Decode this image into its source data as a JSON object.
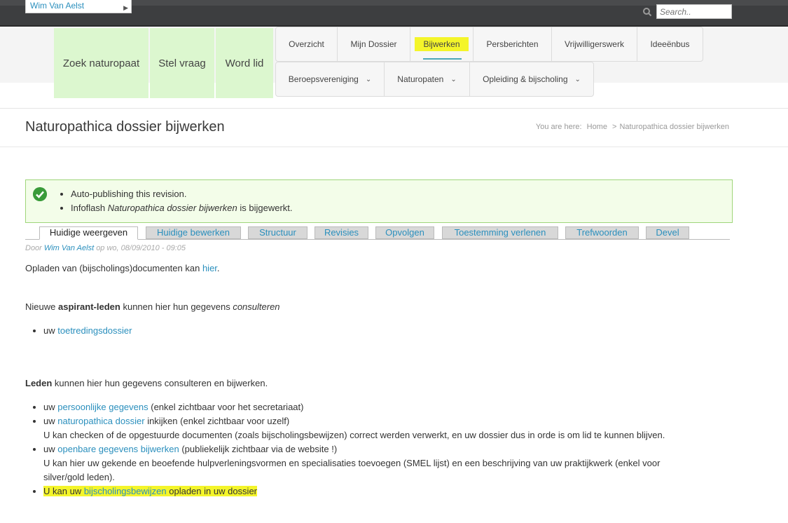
{
  "topbar": {
    "user": "Wim Van Aelst",
    "search_placeholder": "Search.."
  },
  "green_links": [
    "Zoek naturopaat",
    "Stel vraag",
    "Word lid"
  ],
  "nav": {
    "row1": [
      "Overzicht",
      "Mijn Dossier",
      "Bijwerken",
      "Persberichten",
      "Vrijwilligerswerk",
      "Ideeënbus"
    ],
    "row2": [
      "Beroepsvereniging",
      "Naturopaten",
      "Opleiding & bijscholing"
    ]
  },
  "page": {
    "title": "Naturopathica dossier bijwerken",
    "breadcrumb": {
      "prefix": "You are here:",
      "home": "Home",
      "sep": ">",
      "current": "Naturopathica dossier bijwerken"
    }
  },
  "messages": [
    "Auto-publishing this revision.",
    "Infoflash",
    "Naturopathica dossier bijwerken",
    "is bijgewerkt."
  ],
  "tabs": [
    "Huidige weergeven",
    "Huidige bewerken",
    "Structuur",
    "Revisies",
    "Opvolgen",
    "Toestemming verlenen",
    "Trefwoorden",
    "Devel"
  ],
  "byline": {
    "prefix": "Door",
    "author": "Wim Van Aelst",
    "date": "op wo, 08/09/2010 - 09:05"
  },
  "content": {
    "p1_text": "Opladen van (bijscholings)documenten kan",
    "p1_link": "hier",
    "p1_end": ".",
    "p2_a": "Nieuwe",
    "p2_bold": "aspirant-leden",
    "p2_b": "kunnen hier hun gegevens",
    "p2_italic": "consulteren",
    "list1_prefix": "uw",
    "list1_link": "toetredingsdossier",
    "p3_bold": "Leden",
    "p3_text": "kunnen hier hun gegevens consulteren en bijwerken.",
    "li1_link": "persoonlijke gegevens",
    "li1_text": "(enkel zichtbaar voor het secretariaat)",
    "li2_link": "naturopathica dossier",
    "li2_text": "inkijken (enkel zichtbaar voor uzelf)",
    "li2_sub": "U kan checken of de opgestuurde documenten (zoals bijscholingsbewijzen) correct werden verwerkt, en uw dossier dus in orde is om lid te kunnen blijven.",
    "li3_link": "openbare gegevens bijwerken",
    "li3_text": "(publiekelijk zichtbaar via de website !)",
    "li3_sub1": "U kan hier uw gekende en beoefende hulpverleningsvormen en specialisaties toevoegen (SMEL lijst) en een beschrijving van uw praktijkwerk (enkel voor",
    "li3_sub2": "silver/gold leden).",
    "li4_a": "U kan uw",
    "li4_link": "bijscholingsbewijzen",
    "li4_b": "opladen in uw dossier",
    "uw": "uw"
  },
  "colors": {
    "link": "#2a8fbd",
    "highlight": "#f4f52a",
    "green_link_bg": "#dcf7cf",
    "msg_bg": "#f3fde9"
  }
}
